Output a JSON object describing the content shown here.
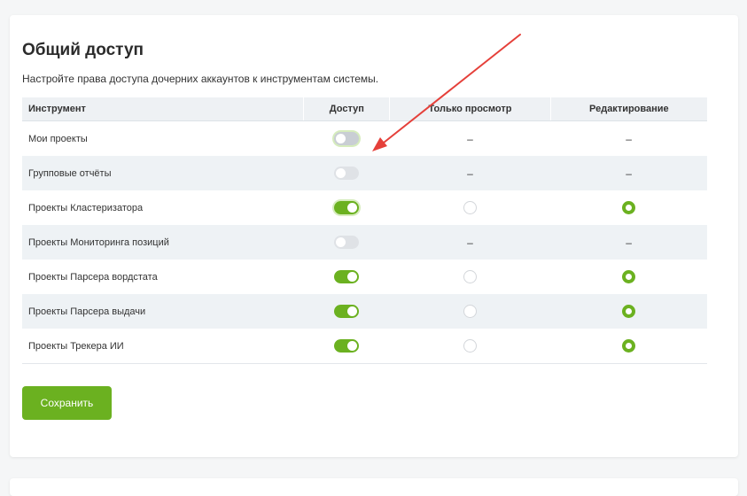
{
  "section": {
    "title": "Общий доступ",
    "description": "Настройте права доступа дочерних аккаунтов к инструментам системы."
  },
  "table": {
    "headers": {
      "tool": "Инструмент",
      "access": "Доступ",
      "view_only": "Только просмотр",
      "edit": "Редактирование"
    },
    "rows": [
      {
        "tool": "Мои проекты",
        "access": "off",
        "view": "–",
        "edit": "–"
      },
      {
        "tool": "Групповые отчёты",
        "access": "off-disabled",
        "view": "–",
        "edit": "–"
      },
      {
        "tool": "Проекты Кластеризатора",
        "access": "on",
        "view": "unchecked",
        "edit": "checked"
      },
      {
        "tool": "Проекты Мониторинга позиций",
        "access": "off-disabled",
        "view": "–",
        "edit": "–"
      },
      {
        "tool": "Проекты Парсера вордстата",
        "access": "on",
        "view": "unchecked",
        "edit": "checked"
      },
      {
        "tool": "Проекты Парсера выдачи",
        "access": "on",
        "view": "unchecked",
        "edit": "checked"
      },
      {
        "tool": "Проекты Трекера ИИ",
        "access": "on",
        "view": "unchecked",
        "edit": "checked"
      }
    ]
  },
  "buttons": {
    "save": "Сохранить"
  },
  "colors": {
    "accent": "#6bb120",
    "toggle_off": "#c9ced4",
    "arrow": "#e5403a",
    "row_alt": "#eef2f5"
  },
  "icons": {
    "annotation": "red-arrow-annotation"
  }
}
